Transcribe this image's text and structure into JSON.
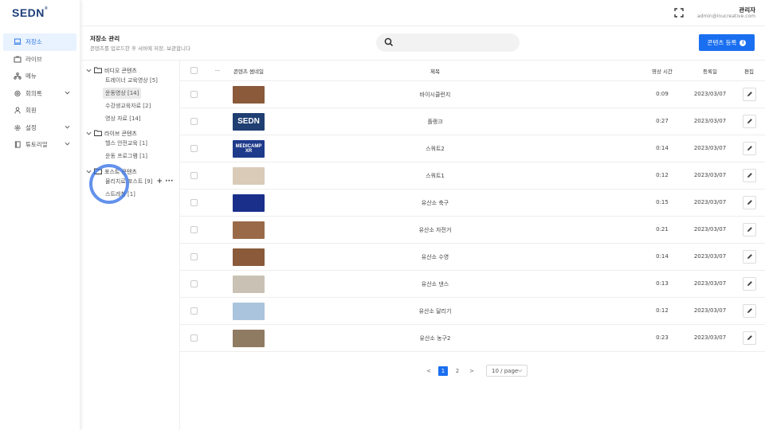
{
  "brand": {
    "logo": "SEDN",
    "reg": "®"
  },
  "sidebar": {
    "items": [
      {
        "label": "저장소",
        "icon": "laptop-icon",
        "active": true,
        "has_children": false
      },
      {
        "label": "라이브",
        "icon": "live-tv-icon",
        "active": false,
        "has_children": false
      },
      {
        "label": "메뉴",
        "icon": "menu-tree-icon",
        "active": false,
        "has_children": false
      },
      {
        "label": "회의록",
        "icon": "settings-icon",
        "active": false,
        "has_children": true
      },
      {
        "label": "회원",
        "icon": "user-icon",
        "active": false,
        "has_children": false
      },
      {
        "label": "설정",
        "icon": "gear-icon",
        "active": false,
        "has_children": true
      },
      {
        "label": "튜토리얼",
        "icon": "book-icon",
        "active": false,
        "has_children": true
      }
    ]
  },
  "header": {
    "user_name": "관리자",
    "user_email": "admin@inucreative.com"
  },
  "page": {
    "title": "저장소 관리",
    "subtitle": "콘텐츠를 업로드한 후 서버에 저장, 보관합니다",
    "search_placeholder": "",
    "register_label": "콘텐츠 등록"
  },
  "tree": {
    "groups": [
      {
        "label": "비디오 콘텐츠",
        "children": [
          "트레이너 교육영상 [5]",
          "운동영상 [14]",
          "수강생교육자료 [2]",
          "영상 자료 [14]"
        ]
      },
      {
        "label": "라이브 콘텐츠",
        "children": [
          "헬스 안전교육 [1]",
          "운동 프로그램 [1]"
        ]
      },
      {
        "label": "포스트 콘텐츠",
        "children": [
          "물리치료 포스트 [9]",
          "스트레칭 [1]"
        ]
      }
    ],
    "selected": "운동영상 [14]",
    "hover_actions": "+ ···"
  },
  "table": {
    "headers": {
      "more": "···",
      "thumbnail": "콘텐츠 썸네일",
      "title": "제목",
      "duration": "영상 시간",
      "date": "등록일",
      "edit": "편집"
    },
    "rows": [
      {
        "thumb_text": "",
        "thumb_color": "#8a5a3a",
        "title": "바이시클런지",
        "duration": "0:09",
        "date": "2023/03/07"
      },
      {
        "thumb_text": "SEDN",
        "thumb_color": "#1f3f73",
        "title": "플랭크",
        "duration": "0:27",
        "date": "2023/03/07"
      },
      {
        "thumb_text": "MEDICAMP XR",
        "thumb_color": "#1e3a8a",
        "title": "스쿼트2",
        "duration": "0:14",
        "date": "2023/03/07"
      },
      {
        "thumb_text": "",
        "thumb_color": "#d9cbb8",
        "title": "스쿼트1",
        "duration": "0:12",
        "date": "2023/03/07"
      },
      {
        "thumb_text": "",
        "thumb_color": "#1a2f8a",
        "title": "유산소 축구",
        "duration": "0:15",
        "date": "2023/03/07"
      },
      {
        "thumb_text": "",
        "thumb_color": "#9a6a48",
        "title": "유산소 자전거",
        "duration": "0:21",
        "date": "2023/03/07"
      },
      {
        "thumb_text": "",
        "thumb_color": "#8a5a3a",
        "title": "유산소 수영",
        "duration": "0:14",
        "date": "2023/03/07"
      },
      {
        "thumb_text": "",
        "thumb_color": "#c9c2b4",
        "title": "유산소 댄스",
        "duration": "0:13",
        "date": "2023/03/07"
      },
      {
        "thumb_text": "",
        "thumb_color": "#a9c4dc",
        "title": "유산소 달리기",
        "duration": "0:12",
        "date": "2023/03/07"
      },
      {
        "thumb_text": "",
        "thumb_color": "#8f7a62",
        "title": "유산소 농구2",
        "duration": "0:23",
        "date": "2023/03/07"
      }
    ]
  },
  "pagination": {
    "prev": "<",
    "pages": [
      "1",
      "2"
    ],
    "current": "1",
    "next": ">",
    "page_size": "10 / page"
  },
  "colors": {
    "accent": "#1a6ff0",
    "logo": "#1e3f7a",
    "active_bg": "#e9f2ff",
    "cursor_ring": "#2f6ee6"
  }
}
